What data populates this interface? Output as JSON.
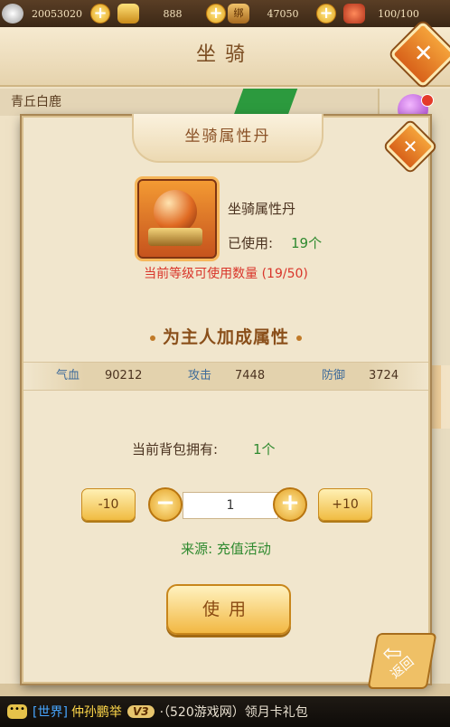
{
  "top_bar": {
    "resources": [
      {
        "icon": "silver-coin-icon",
        "value": "20053020",
        "color": "#c9c9c9"
      },
      {
        "icon": "gold-ingot-icon",
        "value": "888",
        "color": "#e0a92a"
      },
      {
        "icon": "bound-gold-icon",
        "value": "47050",
        "color": "#d99a3c",
        "badge": "绑"
      },
      {
        "icon": "stamina-icon",
        "value": "100/100",
        "color": "#d0432a"
      }
    ],
    "plus_label": "+"
  },
  "background_window": {
    "title": "坐骑",
    "mount_name": "青丘白鹿",
    "close_label": "✕"
  },
  "dialog": {
    "title": "坐骑属性丹",
    "close_label": "✕",
    "item_name": "坐骑属性丹",
    "used_label": "已使用:",
    "used_value": "19个",
    "limit_text": "当前等级可使用数量 (19/50)",
    "section_title": "为主人加成属性",
    "attributes": [
      {
        "label": "气血",
        "value": "90212"
      },
      {
        "label": "攻击",
        "value": "7448"
      },
      {
        "label": "防御",
        "value": "3724"
      }
    ],
    "owned_label": "当前背包拥有:",
    "owned_value": "1个",
    "minus10_label": "-10",
    "minus_label": "−",
    "quantity": "1",
    "plus_label": "+",
    "plus10_label": "+10",
    "source_text": "来源:  充值活动",
    "use_label": "使用"
  },
  "back_button": {
    "arrow": "⇦",
    "label": "返回"
  },
  "chat": {
    "channel": "[世界]",
    "username": "仲孙鹏举",
    "vip": "V3",
    "message": "·（520游戏网）领月卡礼包"
  }
}
